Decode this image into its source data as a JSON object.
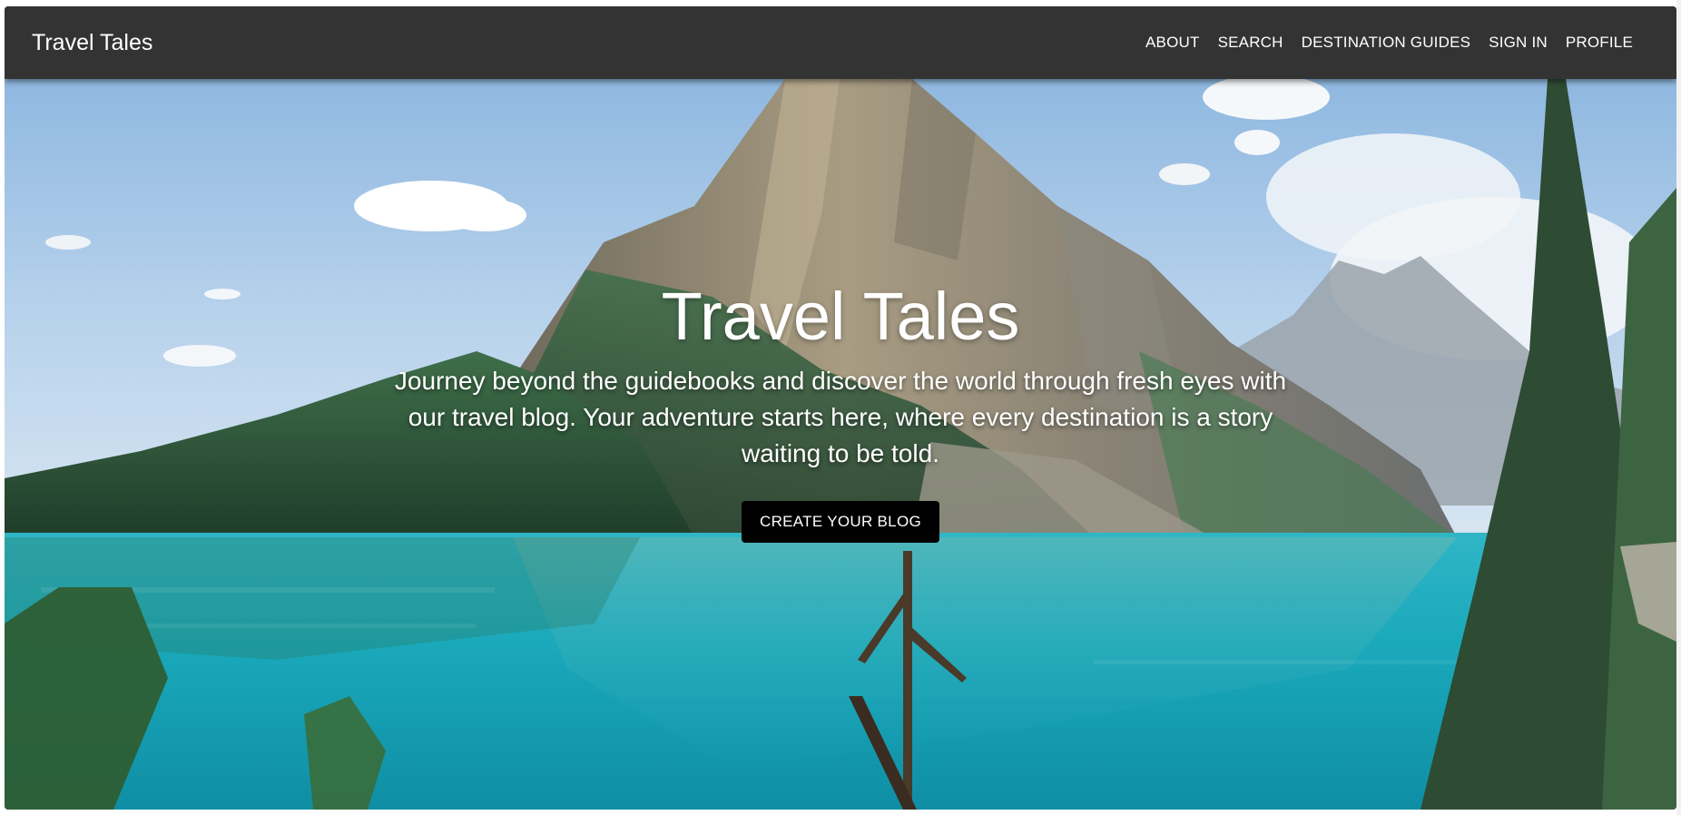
{
  "navbar": {
    "brand": "Travel Tales",
    "links": [
      {
        "label": "ABOUT"
      },
      {
        "label": "SEARCH"
      },
      {
        "label": "DESTINATION GUIDES"
      },
      {
        "label": "SIGN IN"
      },
      {
        "label": "PROFILE"
      }
    ]
  },
  "hero": {
    "title": "Travel Tales",
    "subtitle": "Journey beyond the guidebooks and discover the world through fresh eyes with our travel blog. Your adventure starts here, where every destination is a story waiting to be told.",
    "cta_label": "CREATE YOUR BLOG"
  },
  "colors": {
    "navbar_bg": "#333333",
    "cta_bg": "#000000",
    "text": "#ffffff",
    "lake": "#1fb3c4"
  }
}
